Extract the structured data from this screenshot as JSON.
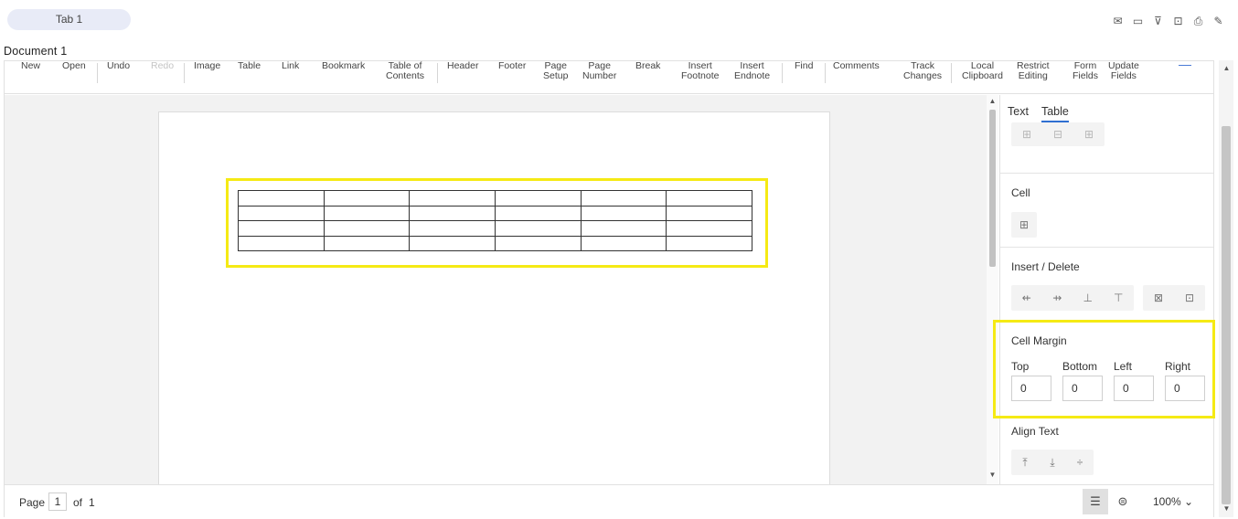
{
  "tabs": [
    {
      "label": "Tab 1"
    }
  ],
  "top_icons": [
    "mail-icon",
    "comment-icon",
    "filter-clear-icon",
    "scan-icon",
    "print-icon",
    "edit-icon"
  ],
  "document": {
    "title": "Document 1"
  },
  "toolbar": {
    "items": [
      {
        "label": "New",
        "disabled": false
      },
      {
        "label": "Open",
        "disabled": false
      },
      {
        "label": "Undo",
        "disabled": false
      },
      {
        "label": "Redo",
        "disabled": true
      },
      {
        "label": "Image",
        "disabled": false
      },
      {
        "label": "Table",
        "disabled": false
      },
      {
        "label": "Link",
        "disabled": false
      },
      {
        "label": "Bookmark",
        "disabled": false
      },
      {
        "label": "Table of\nContents",
        "disabled": false
      },
      {
        "label": "Header",
        "disabled": false
      },
      {
        "label": "Footer",
        "disabled": false
      },
      {
        "label": "Page\nSetup",
        "disabled": false
      },
      {
        "label": "Page\nNumber",
        "disabled": false
      },
      {
        "label": "Break",
        "disabled": false
      },
      {
        "label": "Insert\nFootnote",
        "disabled": false
      },
      {
        "label": "Insert\nEndnote",
        "disabled": false
      },
      {
        "label": "Find",
        "disabled": false
      },
      {
        "label": "Comments",
        "disabled": false
      },
      {
        "label": "Track\nChanges",
        "disabled": false
      },
      {
        "label": "Local\nClipboard",
        "disabled": false
      },
      {
        "label": "Restrict\nEditing",
        "disabled": false
      },
      {
        "label": "Form\nFields",
        "disabled": false
      },
      {
        "label": "Update\nFields",
        "disabled": false
      }
    ]
  },
  "table": {
    "rows": 4,
    "cols": 6
  },
  "panel": {
    "tabs": [
      {
        "label": "Text",
        "active": false
      },
      {
        "label": "Table",
        "active": true
      }
    ],
    "cell_title": "Cell",
    "insert_delete_title": "Insert / Delete",
    "cell_margin": {
      "title": "Cell Margin",
      "fields": [
        {
          "label": "Top",
          "value": "0"
        },
        {
          "label": "Bottom",
          "value": "0"
        },
        {
          "label": "Left",
          "value": "0"
        },
        {
          "label": "Right",
          "value": "0"
        }
      ]
    },
    "align_text_title": "Align Text"
  },
  "status": {
    "page_label": "Page",
    "current_page": "1",
    "of_label": "of",
    "total_pages": "1",
    "zoom": "100%"
  },
  "colors": {
    "highlight": "#f5ea14",
    "accent": "#2f6fd1"
  }
}
